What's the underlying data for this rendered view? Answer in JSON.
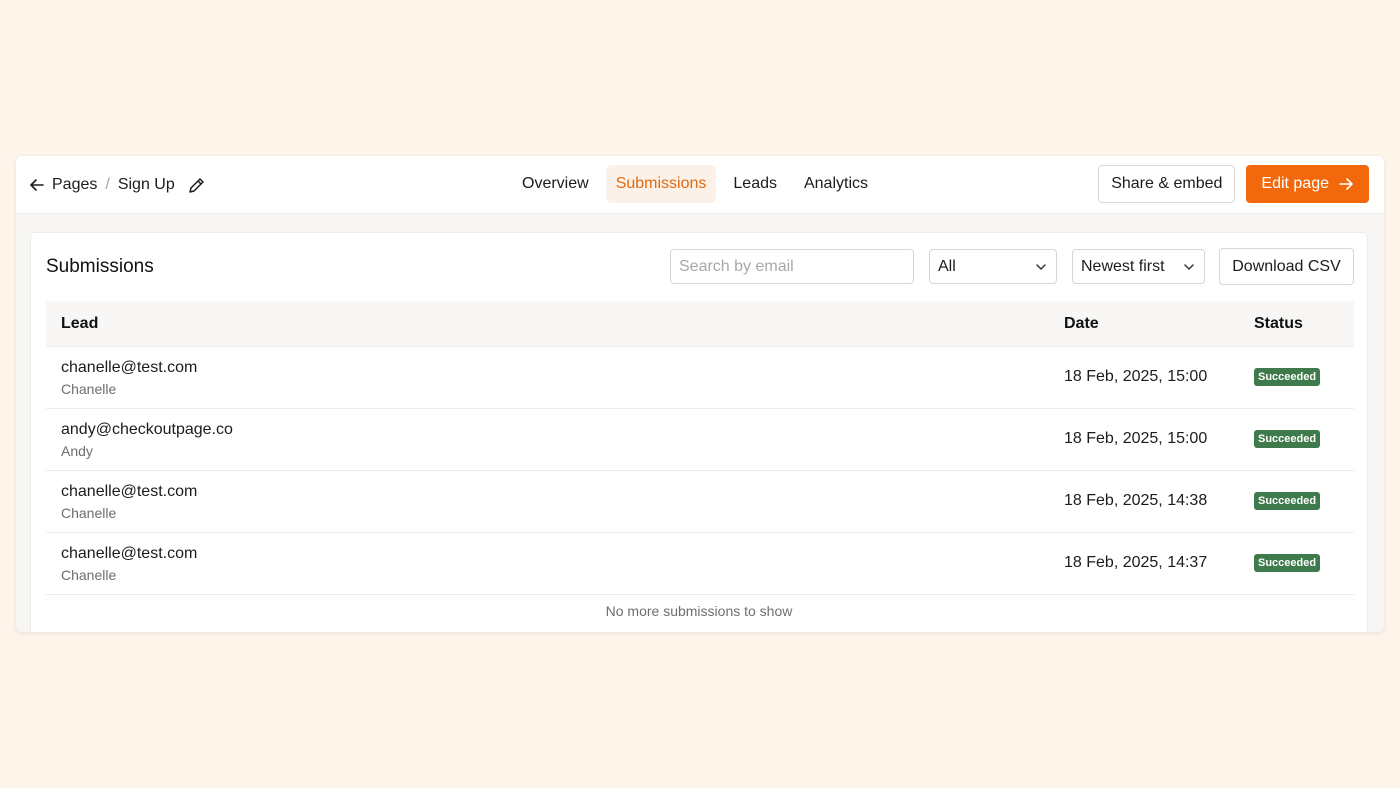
{
  "breadcrumb": {
    "parent": "Pages",
    "separator": "/",
    "current": "Sign Up"
  },
  "nav": {
    "tabs": [
      {
        "label": "Overview"
      },
      {
        "label": "Submissions",
        "active": true
      },
      {
        "label": "Leads"
      },
      {
        "label": "Analytics"
      }
    ]
  },
  "actions": {
    "share_label": "Share & embed",
    "edit_label": "Edit page"
  },
  "panel": {
    "title": "Submissions"
  },
  "search": {
    "placeholder": "Search by email",
    "value": ""
  },
  "filter": {
    "value": "All"
  },
  "sort": {
    "value": "Newest first"
  },
  "download": {
    "label": "Download CSV"
  },
  "table": {
    "headers": {
      "lead": "Lead",
      "date": "Date",
      "status": "Status"
    },
    "rows": [
      {
        "email": "chanelle@test.com",
        "name": "Chanelle",
        "date": "18 Feb, 2025, 15:00",
        "status": "Succeeded"
      },
      {
        "email": "andy@checkoutpage.co",
        "name": "Andy",
        "date": "18 Feb, 2025, 15:00",
        "status": "Succeeded"
      },
      {
        "email": "chanelle@test.com",
        "name": "Chanelle",
        "date": "18 Feb, 2025, 14:38",
        "status": "Succeeded"
      },
      {
        "email": "chanelle@test.com",
        "name": "Chanelle",
        "date": "18 Feb, 2025, 14:37",
        "status": "Succeeded"
      }
    ]
  },
  "footer": {
    "note": "No more submissions to show"
  },
  "colors": {
    "accent": "#f2690d",
    "active_tab_text": "#e06a12",
    "success": "#3e7a4b",
    "background": "#fdf4ea"
  },
  "icons": {
    "back": "arrow-left-icon",
    "edit": "pencil-icon",
    "chevron": "chevron-down-icon",
    "next": "arrow-right-icon"
  }
}
